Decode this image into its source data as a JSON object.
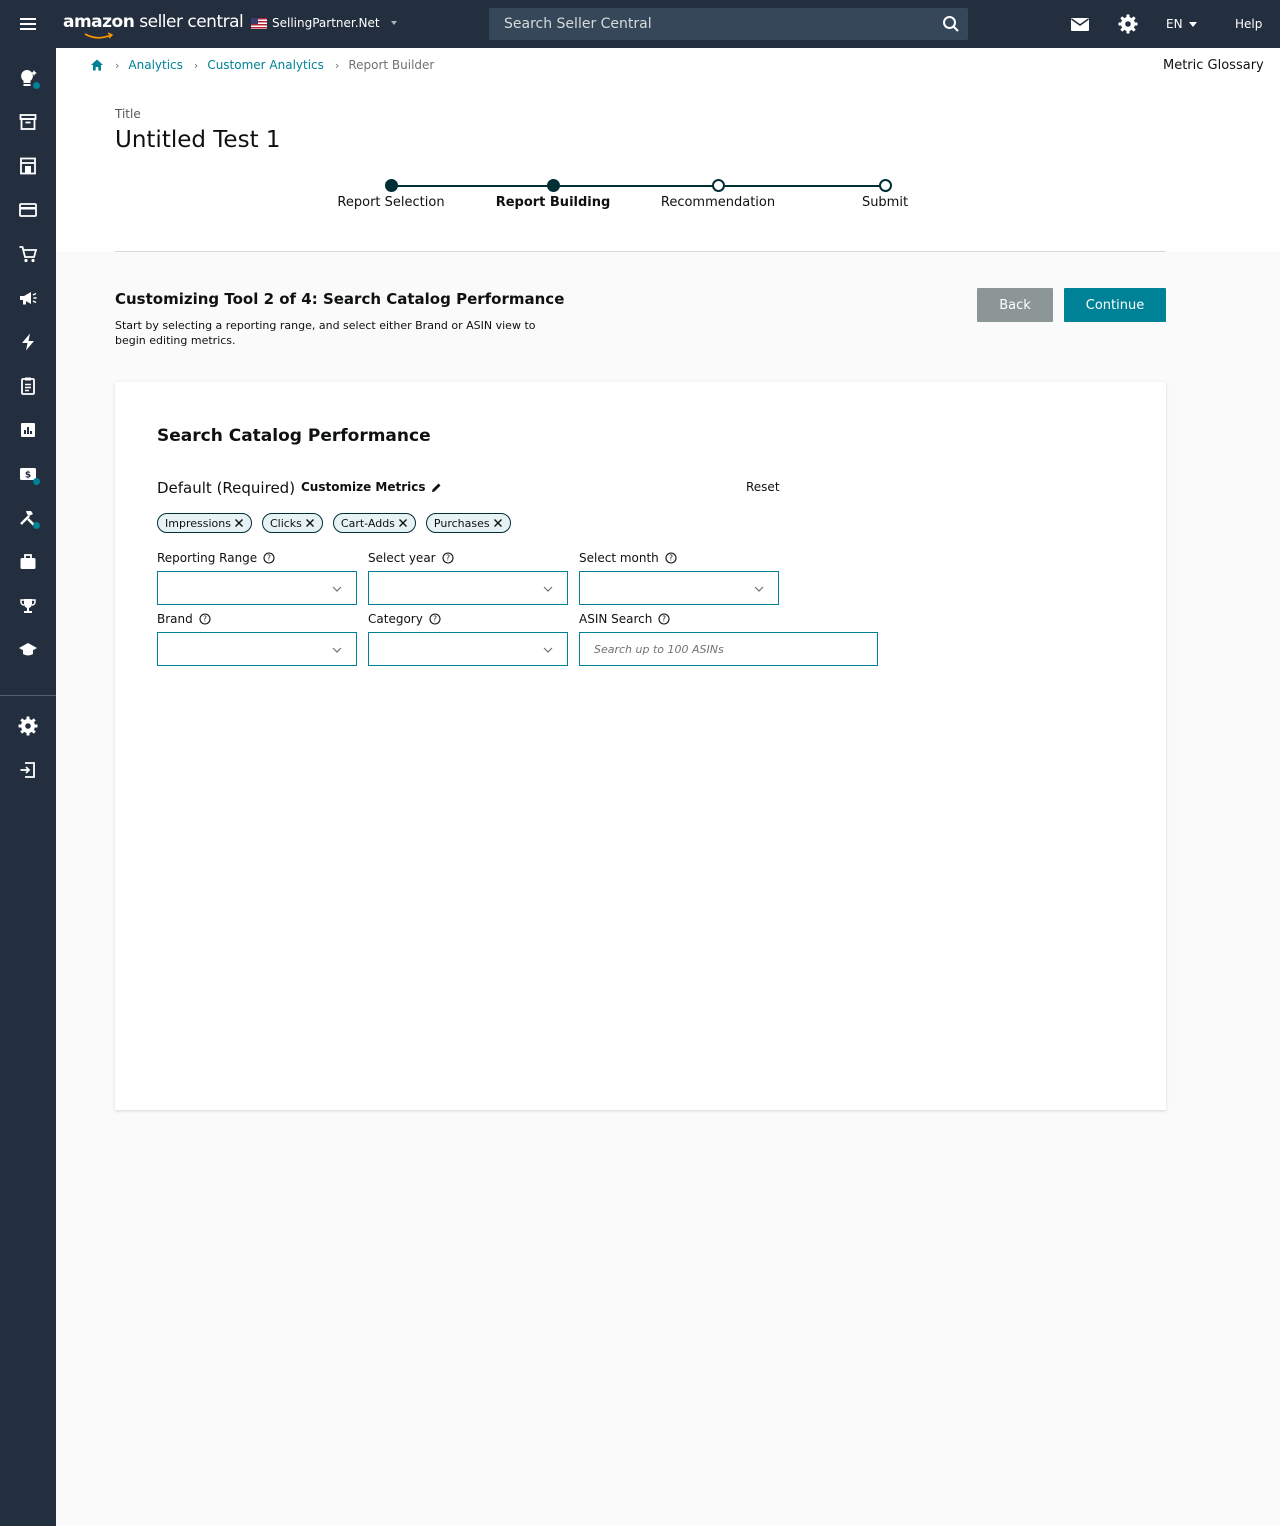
{
  "topbar": {
    "brand_bold": "amazon",
    "brand_rest": " seller central",
    "marketplace": "SellingPartner.Net",
    "search_placeholder": "Search Seller Central",
    "language": "EN",
    "help": "Help"
  },
  "breadcrumb": {
    "items": [
      "Analytics",
      "Customer Analytics"
    ],
    "current": "Report Builder"
  },
  "metric_glossary": "Metric Glossary",
  "title": {
    "label": "Title",
    "value": "Untitled Test 1"
  },
  "stepper": {
    "steps": [
      {
        "label": "Report Selection",
        "state": "done"
      },
      {
        "label": "Report Building",
        "state": "active"
      },
      {
        "label": "Recommendation",
        "state": "todo"
      },
      {
        "label": "Submit",
        "state": "todo"
      }
    ]
  },
  "tool": {
    "title": "Customizing Tool 2 of 4: Search Catalog Performance",
    "description": "Start by selecting a reporting range, and select either Brand or ASIN view to begin editing metrics.",
    "back_label": "Back",
    "continue_label": "Continue"
  },
  "card": {
    "title": "Search Catalog Performance",
    "default_label": "Default (Required)",
    "customize_label": "Customize Metrics",
    "reset_label": "Reset",
    "chips": [
      "Impressions",
      "Clicks",
      "Cart-Adds",
      "Purchases"
    ],
    "fields": {
      "reporting_range": "Reporting Range",
      "select_year": "Select year",
      "select_month": "Select month",
      "brand": "Brand",
      "category": "Category",
      "asin_search": "ASIN Search",
      "asin_placeholder": "Search up to 100 ASINs"
    }
  },
  "colors": {
    "topbar": "#232f3e",
    "accent": "#008296",
    "dark_teal": "#002f36",
    "back_button": "#8d9696"
  }
}
